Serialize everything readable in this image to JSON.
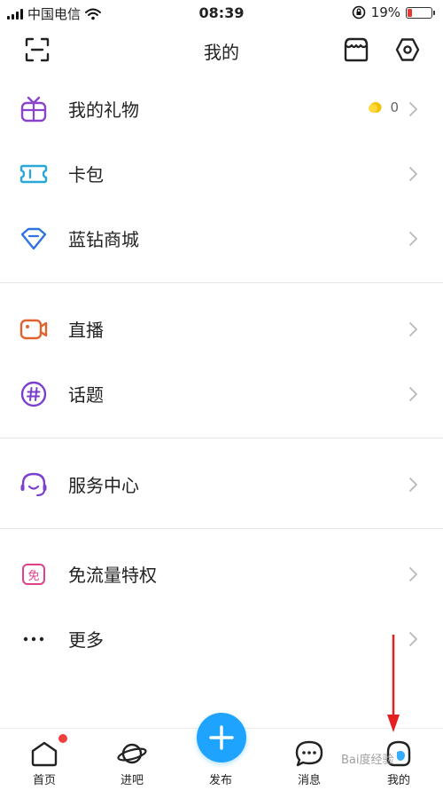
{
  "status_bar": {
    "carrier": "中国电信",
    "time": "08:39",
    "battery_percent": "19%",
    "battery_level": 0.19,
    "battery_color": "#e53935"
  },
  "nav": {
    "title": "我的",
    "left_icon": "scan-icon",
    "right_icons": [
      "store-icon",
      "settings-icon"
    ]
  },
  "menu": {
    "group1": [
      {
        "label": "我的礼物",
        "icon": "gift-icon",
        "extra_value": "0",
        "extra_icon": "coin-icon",
        "color": "#8b44c9"
      },
      {
        "label": "卡包",
        "icon": "card-wallet-icon",
        "color": "#29a7d6"
      },
      {
        "label": "蓝钻商城",
        "icon": "diamond-icon",
        "color": "#2e73e0"
      }
    ],
    "group2": [
      {
        "label": "直播",
        "icon": "video-camera-icon",
        "color": "#e2622e"
      },
      {
        "label": "话题",
        "icon": "hashtag-icon",
        "color": "#7b3fce"
      }
    ],
    "group3": [
      {
        "label": "服务中心",
        "icon": "headset-icon",
        "color": "#7b3fce"
      }
    ],
    "group4": [
      {
        "label": "免流量特权",
        "icon": "free-data-icon",
        "icon_text": "免",
        "color": "#e0408a"
      },
      {
        "label": "更多",
        "icon": "more-dots-icon",
        "color": "#222222"
      }
    ]
  },
  "tabbar": {
    "items": [
      {
        "label": "首页",
        "icon": "home-icon",
        "has_badge": true
      },
      {
        "label": "进吧",
        "icon": "planet-icon"
      },
      {
        "label": "发布",
        "icon": "plus-icon"
      },
      {
        "label": "消息",
        "icon": "message-icon"
      },
      {
        "label": "我的",
        "icon": "profile-icon"
      }
    ],
    "post_color": "#1ea3ff"
  },
  "watermark": "Bai度经验"
}
